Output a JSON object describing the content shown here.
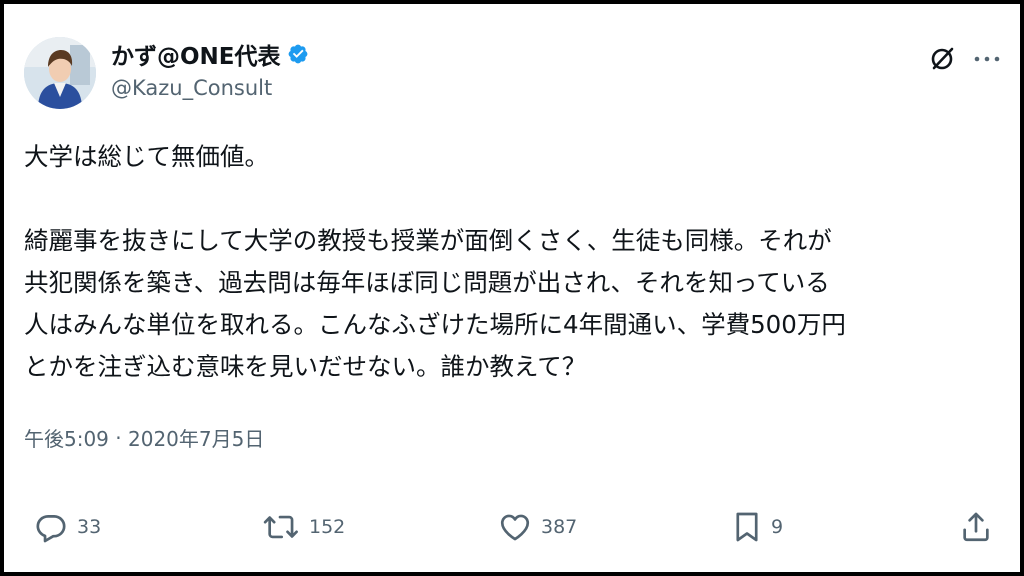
{
  "author": {
    "display_name": "かず@ONE代表",
    "handle": "@Kazu_Consult",
    "verified": true
  },
  "tweet": {
    "lines": [
      "大学は総じて無価値。",
      "",
      "綺麗事を抜きにして大学の教授も授業が面倒くさく、生徒も同様。それが",
      "共犯関係を築き、過去問は毎年ほぼ同じ問題が出され、それを知っている",
      "人はみんな単位を取れる。こんなふざけた場所に4年間通い、学費500万円",
      "とかを注ぎ込む意味を見いだせない。誰か教えて？"
    ],
    "time": "午後5:09",
    "separator": " · ",
    "date": "2020年7月5日"
  },
  "actions": {
    "reply_count": "33",
    "retweet_count": "152",
    "like_count": "387",
    "bookmark_count": "9"
  },
  "icons": {
    "grok": "grok-icon",
    "more": "more-icon",
    "verified": "verified-badge-icon",
    "reply": "reply-icon",
    "retweet": "retweet-icon",
    "like": "like-icon",
    "bookmark": "bookmark-icon",
    "share": "share-icon"
  },
  "colors": {
    "text": "#0f1419",
    "secondary": "#536471",
    "verified": "#1d9bf0",
    "border": "#000000"
  }
}
